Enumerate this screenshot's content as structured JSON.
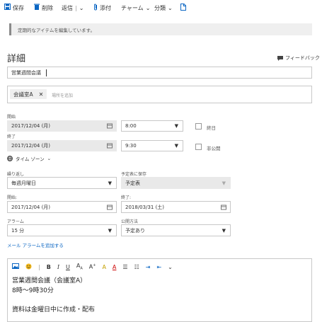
{
  "toolbar": {
    "save": "保存",
    "delete": "削除",
    "reply": "返信",
    "attach": "添付",
    "charm": "チャーム",
    "category": "分類"
  },
  "notice": "定期的なアイテムを編集しています。",
  "title": "詳細",
  "feedback": "フィードバック",
  "event_title": "営業週間会議",
  "location": {
    "chip": "会議室A",
    "placeholder": "場所を追加"
  },
  "start": {
    "label": "開始",
    "date": "2017/12/04 (月)",
    "time": "8:00",
    "allday": "終日"
  },
  "end": {
    "label": "終了",
    "date": "2017/12/04 (月)",
    "time": "9:30",
    "private": "非公開"
  },
  "timezone": "タイム ゾーン",
  "repeat": {
    "label": "繰り返し",
    "value": "毎週月曜日"
  },
  "save_to": {
    "label": "予定表に保存",
    "value": "予定表"
  },
  "range_start": {
    "label": "開始:",
    "value": "2017/12/04 (月)"
  },
  "range_end": {
    "label": "終了:",
    "value": "2018/03/31 (土)"
  },
  "alarm": {
    "label": "アラーム",
    "value": "15 分"
  },
  "publish": {
    "label": "公開方法",
    "value": "予定あり"
  },
  "email_alarm": "メール アラームを追加する",
  "editor": {
    "line1": "営業週間会議（会議室A）",
    "line2": "8時～9時30分",
    "line3": "資料は金曜日中に作成・配布"
  }
}
